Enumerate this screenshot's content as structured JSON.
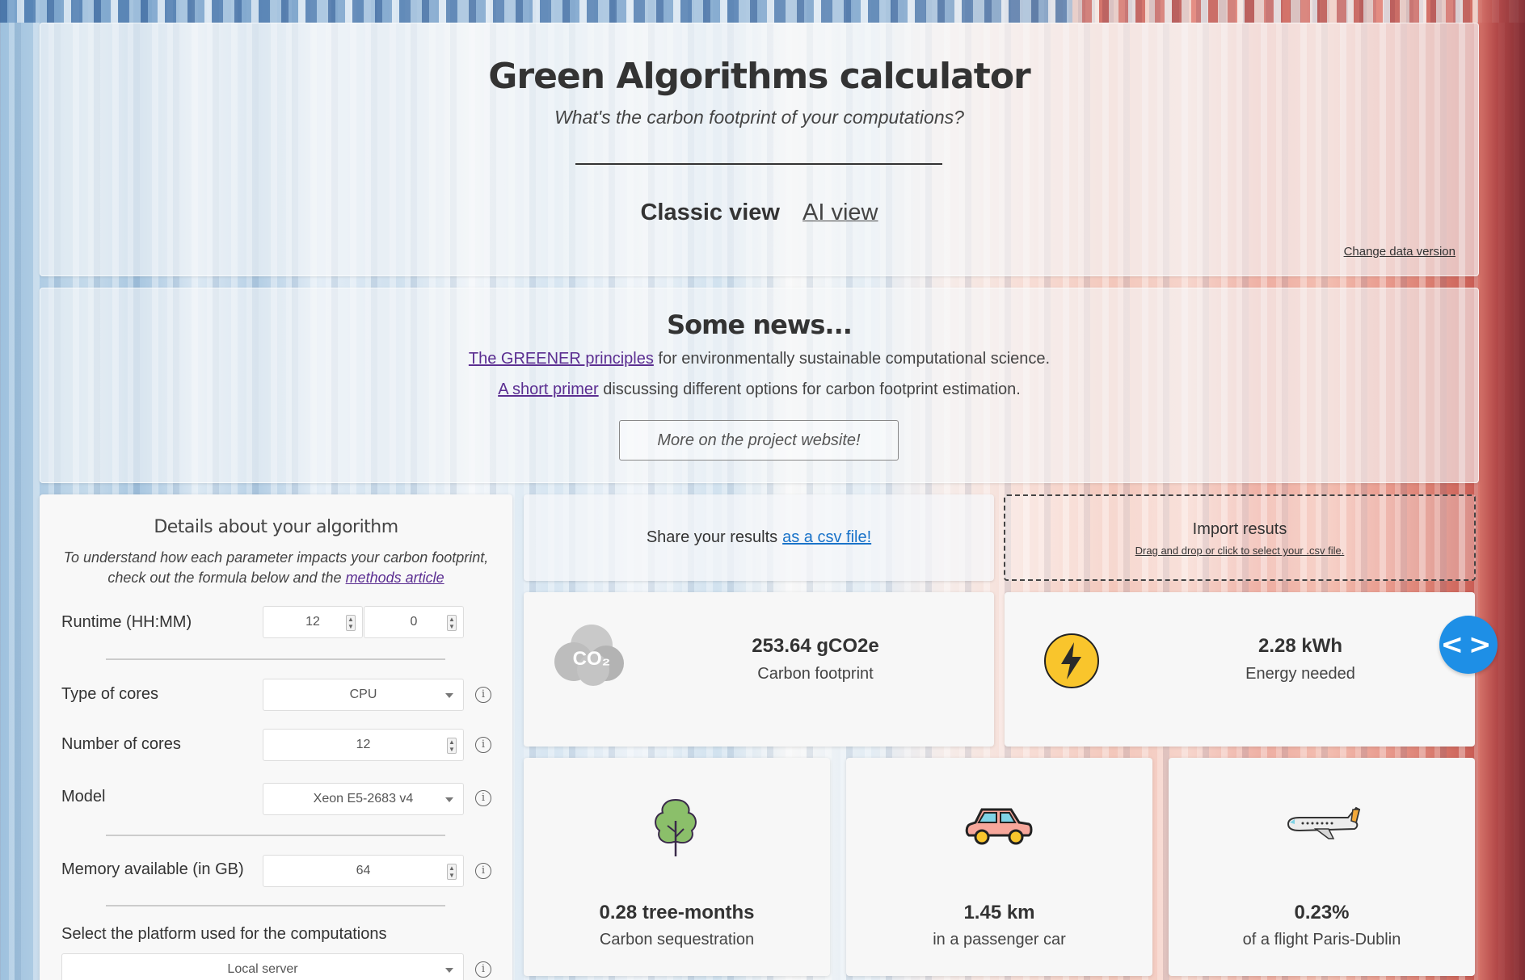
{
  "header": {
    "title": "Green Algorithms calculator",
    "subtitle": "What's the carbon footprint of your computations?",
    "tabs": [
      {
        "label": "Classic view"
      },
      {
        "label": "AI view"
      }
    ],
    "change_version": "Change data version"
  },
  "news": {
    "title": "Some news...",
    "line1_link": "The GREENER principles",
    "line1_rest": " for environmentally sustainable computational science.",
    "line2_link": "A short primer",
    "line2_rest": " discussing different options for carbon footprint estimation.",
    "button": "More on the project website!"
  },
  "form": {
    "title": "Details about your algorithm",
    "desc_text": "To understand how each parameter impacts your carbon footprint, check out the formula below and the ",
    "desc_link": "methods article",
    "runtime_label": "Runtime (HH:MM)",
    "runtime_hours": "12",
    "runtime_minutes": "0",
    "cores_type_label": "Type of cores",
    "cores_type_value": "CPU",
    "num_cores_label": "Number of cores",
    "num_cores_value": "12",
    "model_label": "Model",
    "model_value": "Xeon E5-2683 v4",
    "memory_label": "Memory available (in GB)",
    "memory_value": "64",
    "platform_label": "Select the platform used for the computations",
    "platform_value": "Local server"
  },
  "share": {
    "text": "Share your results",
    "link": "as a csv file!"
  },
  "import": {
    "title": "Import resuts",
    "sub": "Drag and drop or click to select your .csv file."
  },
  "results": {
    "co2_icon_text": "CO₂",
    "carbon_value": "253.64 gCO2e",
    "carbon_label": "Carbon footprint",
    "energy_value": "2.28 kWh",
    "energy_label": "Energy needed",
    "tree_value": "0.28 tree-months",
    "tree_label": "Carbon sequestration",
    "car_value": "1.45 km",
    "car_label": "in a passenger car",
    "flight_value": "0.23%",
    "flight_label": "of a flight Paris-Dublin"
  },
  "colors": {
    "link_purple": "#5b2e91",
    "link_blue": "#1a73c9",
    "toggle_blue": "#1e8fe6",
    "lightning_yellow": "#f9c52c"
  },
  "icons": [
    "co2-cloud-icon",
    "lightning-icon",
    "tree-icon",
    "car-icon",
    "airplane-icon",
    "info-icon",
    "code-toggle-icon"
  ]
}
